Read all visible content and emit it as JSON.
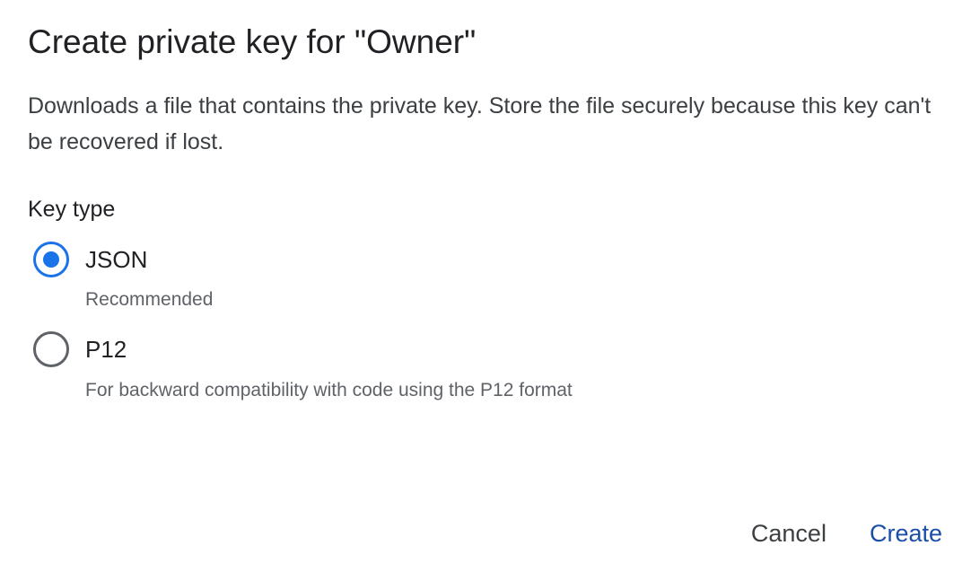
{
  "dialog": {
    "title": "Create private key for \"Owner\"",
    "description": "Downloads a file that contains the private key. Store the file securely because this key can't be recovered if lost.",
    "key_type": {
      "label": "Key type",
      "selected": "JSON",
      "options": [
        {
          "label": "JSON",
          "hint": "Recommended",
          "checked": true
        },
        {
          "label": "P12",
          "hint": "For backward compatibility with code using the P12 format",
          "checked": false
        }
      ]
    },
    "actions": {
      "cancel_label": "Cancel",
      "create_label": "Create"
    },
    "colors": {
      "accent": "#1a73e8",
      "primary_button": "#1a4fa8",
      "text": "#202124",
      "secondary_text": "#5f6368"
    }
  }
}
